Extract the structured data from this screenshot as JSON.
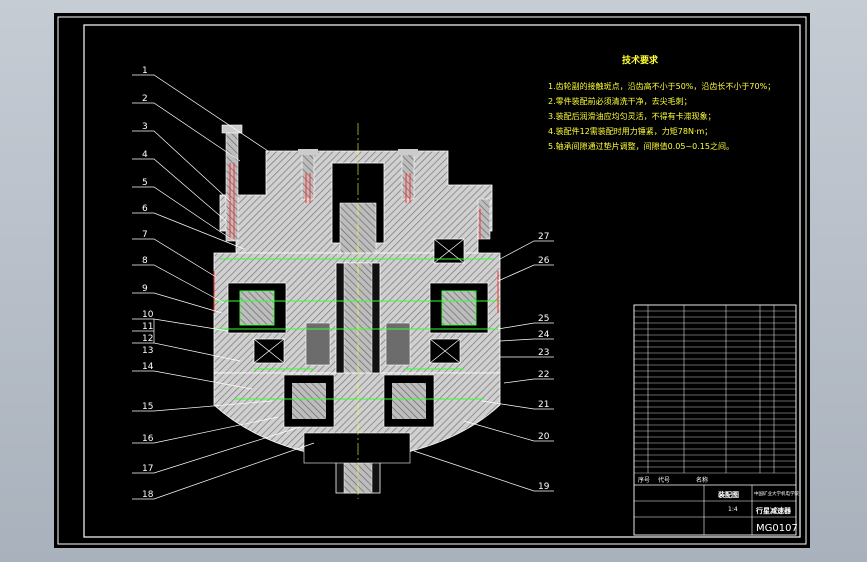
{
  "drawing": {
    "callouts_left": [
      "1",
      "2",
      "3",
      "4",
      "5",
      "6",
      "7",
      "8",
      "9",
      "10",
      "11",
      "12",
      "13",
      "14",
      "15",
      "16",
      "17",
      "18"
    ],
    "callouts_right": [
      "27",
      "26",
      "25",
      "24",
      "23",
      "22",
      "21",
      "20",
      "19"
    ]
  },
  "notes": {
    "title": "技术要求",
    "items": [
      "1.齿轮副的接触斑点，沿齿高不小于50%，沿齿长不小于70%；",
      "2.零件装配前必须清洗干净，去尖毛刺；",
      "3.装配后润滑油应均匀灵活，不得有卡滞现象；",
      "4.装配件12需装配时用力锤紧，力矩78N·m；",
      "5.轴承间隙通过垫片调整，间隙值0.05~0.15之间。"
    ]
  },
  "titleblock": {
    "drawing_name": "行星减速器",
    "drawing_no": "MG0107",
    "assembly_label": "装配图",
    "company": "中国矿业大学机电学院",
    "scale": "1:4",
    "header_seq": "序号",
    "header_code": "代号",
    "header_name": "名称"
  },
  "colors": {
    "frame": "#ffffff",
    "outline": "#33ff33",
    "leader": "#ffffff",
    "text": "#ffff33",
    "hatch": "#ff4444",
    "thread": "#ff3333"
  }
}
